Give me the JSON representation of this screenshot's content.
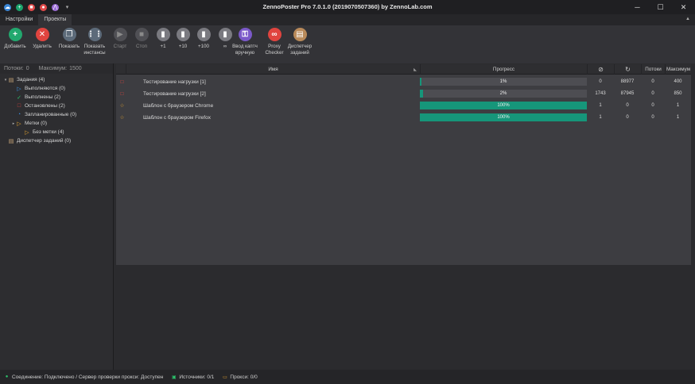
{
  "window": {
    "title": "ZennoPoster Pro 7.0.1.0 (2019070507360) by ZennoLab.com",
    "controls": {
      "minimize": "─",
      "maximize": "☐",
      "close": "✕"
    }
  },
  "quick_access": [
    {
      "icon": "zennoposter-logo-icon",
      "glyph": "☁",
      "color": "#3a86d6"
    },
    {
      "icon": "add-icon",
      "glyph": "+",
      "color": "#1aa36b"
    },
    {
      "icon": "stop-icon",
      "glyph": "■",
      "color": "#e04a4a"
    },
    {
      "icon": "record-icon",
      "glyph": "●",
      "color": "#e04a4a"
    },
    {
      "icon": "activity-icon",
      "glyph": "⋀",
      "color": "#9b6bd6"
    },
    {
      "icon": "dropdown-icon",
      "glyph": "▾",
      "color": "transparent"
    }
  ],
  "tabs": [
    "Настройки",
    "Проекты"
  ],
  "active_tab": 1,
  "toolbar": [
    {
      "label": "Добавить",
      "glyph": "+",
      "color": "#22a86e",
      "name": "add-button",
      "icon": "plus-icon",
      "disabled": false
    },
    {
      "label": "Удалить",
      "glyph": "✕",
      "color": "#e0443f",
      "name": "delete-button",
      "icon": "cross-icon",
      "disabled": false
    },
    {
      "label": "Показать",
      "glyph": "❐",
      "color": "#5d6b7a",
      "name": "show-button",
      "icon": "window-icon",
      "disabled": false
    },
    {
      "label": "Показать\nинстансы",
      "glyph": "⋮⋮",
      "color": "#5d6b7a",
      "name": "show-instances-button",
      "icon": "grid-icon",
      "disabled": false
    },
    {
      "label": "Старт",
      "glyph": "▶",
      "color": "#505055",
      "name": "start-button",
      "icon": "play-icon",
      "disabled": true
    },
    {
      "label": "Стоп",
      "glyph": "■",
      "color": "#505055",
      "name": "stop-button",
      "icon": "stop-icon",
      "disabled": true
    },
    {
      "label": "+1",
      "glyph": "▮",
      "color": "#7a7a80",
      "name": "plus-1-button",
      "icon": "clipboard-icon",
      "disabled": false
    },
    {
      "label": "+10",
      "glyph": "▮",
      "color": "#7a7a80",
      "name": "plus-10-button",
      "icon": "clipboard-icon",
      "disabled": false
    },
    {
      "label": "+100",
      "glyph": "▮",
      "color": "#7a7a80",
      "name": "plus-100-button",
      "icon": "clipboard-icon",
      "disabled": false
    },
    {
      "label": "∞",
      "glyph": "▮",
      "color": "#7a7a80",
      "name": "infinite-button",
      "icon": "clipboard-icon",
      "disabled": false
    },
    {
      "label": "Ввод каптч\nвручную",
      "glyph": "⚿",
      "color": "#7b59c9",
      "name": "manual-captcha-button",
      "icon": "captcha-icon",
      "disabled": false
    },
    {
      "label": "Proxy\nChecker",
      "glyph": "∞",
      "color": "#e0443f",
      "name": "proxy-checker-button",
      "icon": "chain-icon",
      "disabled": false
    },
    {
      "label": "Диспетчер\nзаданий",
      "glyph": "▤",
      "color": "#b98a5a",
      "name": "task-manager-button",
      "icon": "scheduler-icon",
      "disabled": false
    }
  ],
  "sidebar": {
    "threads_label": "Потоки:",
    "threads_value": "0",
    "max_label": "Максимум:",
    "max_value": "1500",
    "tree": [
      {
        "label": "Задания (4)",
        "level": 0,
        "expander": "▾",
        "icon": "tasks-icon",
        "glyph": "▤",
        "color": "#c9a77a"
      },
      {
        "label": "Выполняются (0)",
        "level": 1,
        "expander": "",
        "icon": "running-icon",
        "glyph": "▷",
        "color": "#3a8fe0"
      },
      {
        "label": "Выполнены (2)",
        "level": 1,
        "expander": "",
        "icon": "check-icon",
        "glyph": "✓",
        "color": "#2cc36b"
      },
      {
        "label": "Остановлены (2)",
        "level": 1,
        "expander": "",
        "icon": "stopped-icon",
        "glyph": "□",
        "color": "#e0443f"
      },
      {
        "label": "Запланированные (0)",
        "level": 1,
        "expander": "",
        "icon": "clock-icon",
        "glyph": "◔",
        "color": "#3a8fe0"
      },
      {
        "label": "Метки (0)",
        "level": 1,
        "expander": "▸",
        "icon": "tag-icon",
        "glyph": "▷",
        "color": "#e0a030"
      },
      {
        "label": "Без метки (4)",
        "level": 2,
        "expander": "",
        "icon": "tag-icon",
        "glyph": "▷",
        "color": "#e0a030"
      },
      {
        "label": "Диспетчер заданий (0)",
        "level": 0,
        "expander": "",
        "icon": "scheduler-icon",
        "glyph": "▤",
        "color": "#c9a77a"
      }
    ]
  },
  "grid": {
    "columns": {
      "name": "Имя",
      "progress": "Прогресс",
      "done_icon": "check-circle-icon",
      "repeat_icon": "refresh-icon",
      "threads": "Потоки",
      "max": "Максимум"
    },
    "rows": [
      {
        "status_icon": "stopped-icon",
        "status_glyph": "□",
        "status_color": "#e0443f",
        "name": "Тестирование нагрузки [1]",
        "progress": 1,
        "progress_label": "1%",
        "done": "0",
        "attempts": "88977",
        "threads": "0",
        "max": "400"
      },
      {
        "status_icon": "stopped-icon",
        "status_glyph": "□",
        "status_color": "#e0443f",
        "name": "Тестирование нагрузки [2]",
        "progress": 2,
        "progress_label": "2%",
        "done": "1743",
        "attempts": "87945",
        "threads": "0",
        "max": "850"
      },
      {
        "status_icon": "star-icon",
        "status_glyph": "☆",
        "status_color": "#e0a030",
        "name": "Шаблон с браузером Chrome",
        "progress": 100,
        "progress_label": "100%",
        "done": "1",
        "attempts": "0",
        "threads": "0",
        "max": "1"
      },
      {
        "status_icon": "star-icon",
        "status_glyph": "☆",
        "status_color": "#e0a030",
        "name": "Шаблон с браузером Firefox",
        "progress": 100,
        "progress_label": "100%",
        "done": "1",
        "attempts": "0",
        "threads": "0",
        "max": "1"
      }
    ]
  },
  "statusbar": {
    "connection": "Соединение: Подключено / Сервер проверки прокси: Доступен",
    "sources": "Источники: 0/1",
    "proxies": "Прокси: 0/0"
  }
}
